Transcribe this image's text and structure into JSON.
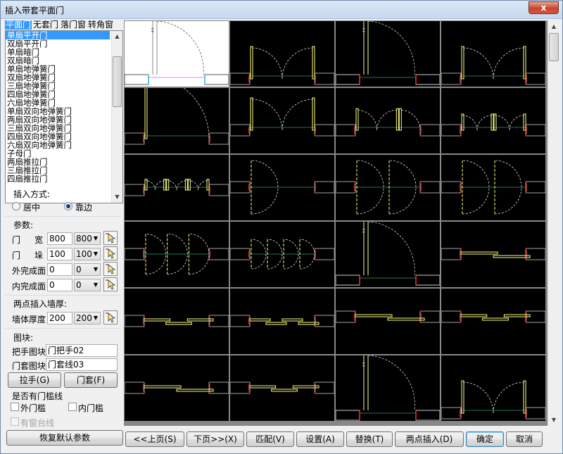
{
  "window": {
    "title": "插入带套平面门",
    "close_glyph": "x"
  },
  "tabs": [
    {
      "label": "平面门",
      "selected": true
    },
    {
      "label": "无套门",
      "selected": false
    },
    {
      "label": "落门窗",
      "selected": false
    },
    {
      "label": "转角窗",
      "selected": false
    }
  ],
  "door_list": [
    "单扇平开门",
    "双扇平开门",
    "单扇暗门",
    "双扇暗门",
    "单扇地弹簧门",
    "双扇地弹簧门",
    "三扇地弹簧门",
    "四扇地弹簧门",
    "六扇地弹簧门",
    "单扇双向地弹簧门",
    "两扇双向地弹簧门",
    "三扇双向地弹簧门",
    "四扇双向地弹簧门",
    "六扇双向地弹簧门",
    "子母门",
    "两扇推拉门",
    "三扇推拉门",
    "四扇推拉门"
  ],
  "insert_mode": {
    "label": "插入方式:",
    "options": [
      "居中",
      "靠边"
    ],
    "selected": "靠边"
  },
  "params": {
    "label": "参数:",
    "width": {
      "label1": "门",
      "label2": "宽",
      "value": "800",
      "combo": "800"
    },
    "jamb": {
      "label1": "门",
      "label2": "垛",
      "value": "100",
      "combo": "100"
    },
    "outer_surface": {
      "label": "外完成面",
      "value": "0",
      "combo": "0"
    },
    "inner_surface": {
      "label": "内完成面",
      "value": "0",
      "combo": "0"
    }
  },
  "wall": {
    "label": "两点插入墙厚:",
    "thickness_label": "墙体厚度",
    "value": "200",
    "combo": "200"
  },
  "blocks": {
    "label": "图块:",
    "handle_label": "把手图块",
    "handle_value": "门把手02",
    "frame_label": "门套图块",
    "frame_value": "门套线03",
    "handle_button": "拉手(G)",
    "frame_button": "门套(F)"
  },
  "threshold": {
    "label": "是否有门槛线",
    "outer": "外门槛",
    "inner": "内门槛",
    "sill": "有窗台线"
  },
  "buttons": {
    "restore": "恢复默认参数",
    "prev": "<<上页(S)",
    "next": "下页>>(X)",
    "match": "匹配(V)",
    "settings": "设置(A)",
    "replace": "替换(T)",
    "two_point": "两点插入(D)",
    "ok": "确定",
    "cancel": "取消"
  },
  "thumbnails": [
    {
      "type": "single-swing",
      "selected": true
    },
    {
      "type": "double-swing"
    },
    {
      "type": "single-swing-frame"
    },
    {
      "type": "double-swing-frame"
    },
    {
      "type": "single-spring"
    },
    {
      "type": "double-spring"
    },
    {
      "type": "triple-spring"
    },
    {
      "type": "quad-spring"
    },
    {
      "type": "six-spring"
    },
    {
      "type": "single-two-way"
    },
    {
      "type": "double-two-way"
    },
    {
      "type": "triple-two-way"
    },
    {
      "type": "quad-two-way"
    },
    {
      "type": "six-two-way"
    },
    {
      "type": "mother-child"
    },
    {
      "type": "sliding-2"
    },
    {
      "type": "sliding-3"
    },
    {
      "type": "sliding-4"
    },
    {
      "type": "sliding-2b"
    },
    {
      "type": "sliding-3b"
    },
    {
      "type": "sliding-2c"
    },
    {
      "type": "sliding-4c"
    },
    {
      "type": "single-swing-b"
    },
    {
      "type": "double-swing-b"
    }
  ],
  "colors": {
    "accent": "#3399ff",
    "thumb_bg": "#000000",
    "door_line": "#ffff80",
    "wall_red": "#ff3030",
    "guide_green": "#2e9a6a"
  }
}
